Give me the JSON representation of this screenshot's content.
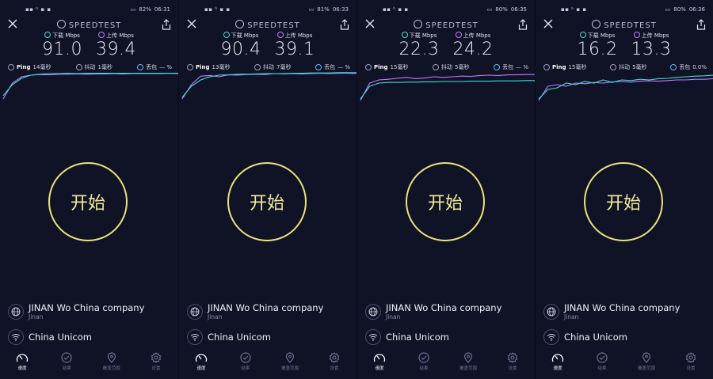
{
  "colors": {
    "background": "#101226",
    "download": "#3fe0d0",
    "upload": "#c27bff",
    "start_ring": "#e9e47a",
    "text": "#f1f1f8"
  },
  "icons": {
    "close": "close-icon",
    "share": "share-icon",
    "globe": "globe-icon",
    "wifi": "wifi-icon",
    "speed": "speedometer-icon",
    "results": "check-circle-icon",
    "coverage": "map-pin-icon",
    "settings": "gear-icon"
  },
  "panels": [
    {
      "status": {
        "time": "06:31",
        "battery": "82%"
      },
      "app_title": "SPEEDTEST",
      "download": {
        "label": "下载 Mbps",
        "value": "91.0"
      },
      "upload": {
        "label": "上传 Mbps",
        "value": "39.4"
      },
      "ping": {
        "label": "Ping",
        "value": "14毫秒"
      },
      "jitter": {
        "label": "抖动",
        "value": "1毫秒"
      },
      "loss": {
        "label": "丢包",
        "value": "— %"
      },
      "start_label": "开始",
      "server": {
        "name": "JINAN Wo China company",
        "city": "Jinan"
      },
      "isp": "China Unicom",
      "nav": [
        "速度",
        "结果",
        "覆盖范围",
        "设置"
      ],
      "graph": {
        "download": [
          0.2,
          0.55,
          0.75,
          0.85,
          0.88,
          0.9,
          0.9,
          0.91,
          0.9,
          0.91,
          0.91,
          0.91,
          0.91,
          0.91,
          0.91,
          0.91,
          0.91,
          0.91,
          0.91,
          0.91
        ],
        "upload": [
          0.1,
          0.6,
          0.8,
          0.85,
          0.87,
          0.86,
          0.88,
          0.88,
          0.89,
          0.88,
          0.89,
          0.89,
          0.9,
          0.89,
          0.9,
          0.9,
          0.9,
          0.9,
          0.91,
          0.9
        ]
      }
    },
    {
      "status": {
        "time": "06:33",
        "battery": "81%"
      },
      "app_title": "SPEEDTEST",
      "download": {
        "label": "下载 Mbps",
        "value": "90.4"
      },
      "upload": {
        "label": "上传 Mbps",
        "value": "39.1"
      },
      "ping": {
        "label": "Ping",
        "value": "13毫秒"
      },
      "jitter": {
        "label": "抖动",
        "value": "7毫秒"
      },
      "loss": {
        "label": "丢包",
        "value": "— %"
      },
      "start_label": "开始",
      "server": {
        "name": "JINAN Wo China company",
        "city": "Jinan"
      },
      "isp": "China Unicom",
      "nav": [
        "速度",
        "结果",
        "覆盖范围",
        "设置"
      ],
      "graph": {
        "download": [
          0.15,
          0.5,
          0.7,
          0.8,
          0.85,
          0.86,
          0.88,
          0.88,
          0.89,
          0.9,
          0.9,
          0.9,
          0.91,
          0.91,
          0.92,
          0.92,
          0.92,
          0.93,
          0.93,
          0.93
        ],
        "upload": [
          0.1,
          0.55,
          0.82,
          0.84,
          0.8,
          0.86,
          0.85,
          0.87,
          0.88,
          0.87,
          0.9,
          0.89,
          0.9,
          0.89,
          0.9,
          0.91,
          0.9,
          0.91,
          0.91,
          0.9
        ]
      }
    },
    {
      "status": {
        "time": "06:35",
        "battery": "80%"
      },
      "app_title": "SPEEDTEST",
      "download": {
        "label": "下载 Mbps",
        "value": "22.3"
      },
      "upload": {
        "label": "上传 Mbps",
        "value": "24.2"
      },
      "ping": {
        "label": "Ping",
        "value": "15毫秒"
      },
      "jitter": {
        "label": "抖动",
        "value": "5毫秒"
      },
      "loss": {
        "label": "丢包",
        "value": "— %"
      },
      "start_label": "开始",
      "server": {
        "name": "JINAN Wo China company",
        "city": "Jinan"
      },
      "isp": "China Unicom",
      "nav": [
        "速度",
        "结果",
        "覆盖范围",
        "设置"
      ],
      "graph": {
        "download": [
          0.1,
          0.5,
          0.6,
          0.62,
          0.62,
          0.63,
          0.63,
          0.64,
          0.64,
          0.65,
          0.65,
          0.65,
          0.66,
          0.66,
          0.66,
          0.67,
          0.67,
          0.67,
          0.68,
          0.68
        ],
        "upload": [
          0.05,
          0.6,
          0.7,
          0.72,
          0.75,
          0.78,
          0.74,
          0.76,
          0.8,
          0.78,
          0.8,
          0.82,
          0.81,
          0.84,
          0.85,
          0.84,
          0.86,
          0.86,
          0.87,
          0.87
        ]
      }
    },
    {
      "status": {
        "time": "06:36",
        "battery": "80%"
      },
      "app_title": "SPEEDTEST",
      "download": {
        "label": "下载 Mbps",
        "value": "16.2"
      },
      "upload": {
        "label": "上传 Mbps",
        "value": "13.3"
      },
      "ping": {
        "label": "Ping",
        "value": "15毫秒"
      },
      "jitter": {
        "label": "抖动",
        "value": "5毫秒"
      },
      "loss": {
        "label": "丢包",
        "value": "0.0%"
      },
      "start_label": "开始",
      "server": {
        "name": "JINAN Wo China company",
        "city": "Jinan"
      },
      "isp": "China Unicom",
      "nav": [
        "速度",
        "结果",
        "覆盖范围",
        "设置"
      ],
      "graph": {
        "download": [
          0.1,
          0.4,
          0.45,
          0.6,
          0.55,
          0.65,
          0.6,
          0.7,
          0.62,
          0.7,
          0.68,
          0.72,
          0.7,
          0.74,
          0.75,
          0.78,
          0.8,
          0.82,
          0.83,
          0.85
        ],
        "upload": [
          0.05,
          0.5,
          0.55,
          0.5,
          0.6,
          0.58,
          0.62,
          0.6,
          0.64,
          0.65,
          0.63,
          0.66,
          0.67,
          0.66,
          0.68,
          0.7,
          0.7,
          0.72,
          0.72,
          0.74
        ]
      }
    }
  ]
}
